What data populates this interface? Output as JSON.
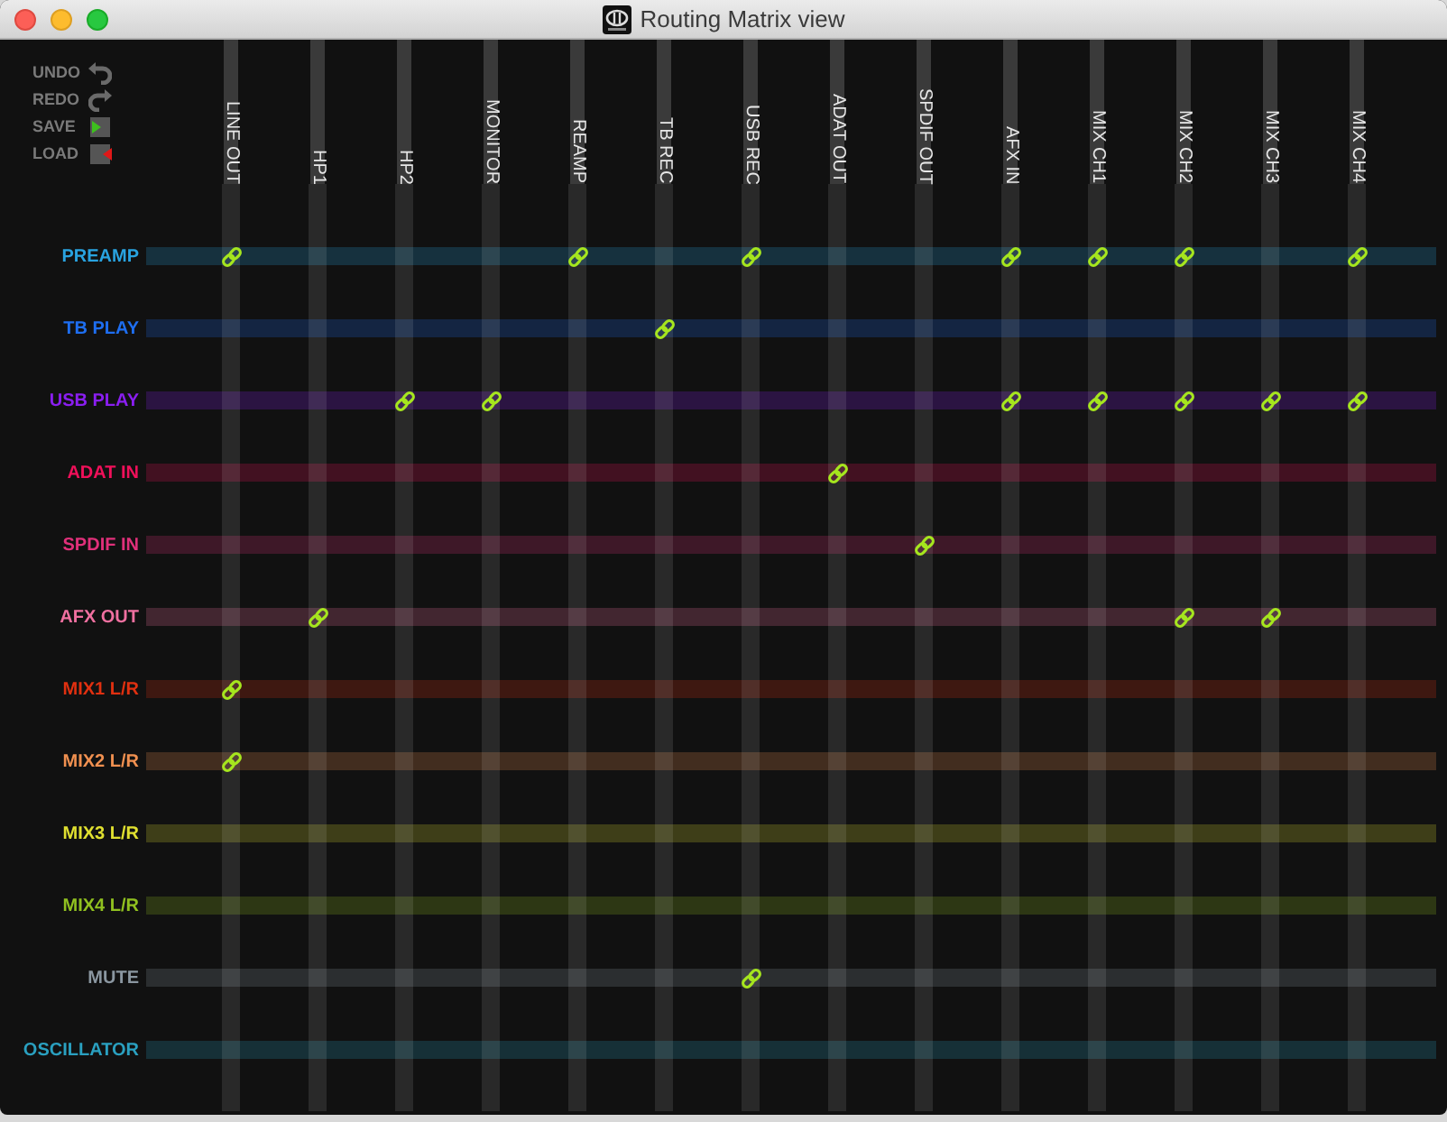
{
  "window": {
    "title": "Routing Matrix view"
  },
  "toolbar": [
    {
      "label": "UNDO",
      "kind": "undo"
    },
    {
      "label": "REDO",
      "kind": "redo"
    },
    {
      "label": "SAVE",
      "kind": "save"
    },
    {
      "label": "LOAD",
      "kind": "load"
    }
  ],
  "columns": [
    "LINE OUT",
    "HP1",
    "HP2",
    "MONITOR",
    "REAMP",
    "TB REC",
    "USB REC",
    "ADAT OUT",
    "SPDIF OUT",
    "AFX IN",
    "MIX CH1",
    "MIX CH2",
    "MIX CH3",
    "MIX CH4"
  ],
  "rows": [
    {
      "label": "PREAMP",
      "color": "#29a3e0",
      "connections": [
        true,
        false,
        false,
        false,
        true,
        false,
        true,
        false,
        false,
        true,
        true,
        true,
        false,
        true
      ]
    },
    {
      "label": "TB PLAY",
      "color": "#1e6ef0",
      "connections": [
        false,
        false,
        false,
        false,
        false,
        true,
        false,
        false,
        false,
        false,
        false,
        false,
        false,
        false
      ]
    },
    {
      "label": "USB PLAY",
      "color": "#8a1ef0",
      "connections": [
        false,
        false,
        true,
        true,
        false,
        false,
        false,
        false,
        false,
        true,
        true,
        true,
        true,
        true
      ]
    },
    {
      "label": "ADAT IN",
      "color": "#f0105a",
      "connections": [
        false,
        false,
        false,
        false,
        false,
        false,
        false,
        true,
        false,
        false,
        false,
        false,
        false,
        false
      ]
    },
    {
      "label": "SPDIF IN",
      "color": "#e0307a",
      "connections": [
        false,
        false,
        false,
        false,
        false,
        false,
        false,
        false,
        true,
        false,
        false,
        false,
        false,
        false
      ]
    },
    {
      "label": "AFX OUT",
      "color": "#f070a0",
      "connections": [
        false,
        true,
        false,
        false,
        false,
        false,
        false,
        false,
        false,
        false,
        false,
        true,
        true,
        false
      ]
    },
    {
      "label": "MIX1 L/R",
      "color": "#e03010",
      "connections": [
        true,
        false,
        false,
        false,
        false,
        false,
        false,
        false,
        false,
        false,
        false,
        false,
        false,
        false
      ]
    },
    {
      "label": "MIX2 L/R",
      "color": "#f09050",
      "connections": [
        true,
        false,
        false,
        false,
        false,
        false,
        false,
        false,
        false,
        false,
        false,
        false,
        false,
        false
      ]
    },
    {
      "label": "MIX3 L/R",
      "color": "#e0e030",
      "connections": [
        false,
        false,
        false,
        false,
        false,
        false,
        false,
        false,
        false,
        false,
        false,
        false,
        false,
        false
      ]
    },
    {
      "label": "MIX4 L/R",
      "color": "#90c020",
      "connections": [
        false,
        false,
        false,
        false,
        false,
        false,
        false,
        false,
        false,
        false,
        false,
        false,
        false,
        false
      ]
    },
    {
      "label": "MUTE",
      "color": "#8a96a0",
      "connections": [
        false,
        false,
        false,
        false,
        false,
        false,
        true,
        false,
        false,
        false,
        false,
        false,
        false,
        false
      ]
    },
    {
      "label": "OSCILLATOR",
      "color": "#2aa0c0",
      "connections": [
        false,
        false,
        false,
        false,
        false,
        false,
        false,
        false,
        false,
        false,
        false,
        false,
        false,
        false
      ]
    }
  ]
}
